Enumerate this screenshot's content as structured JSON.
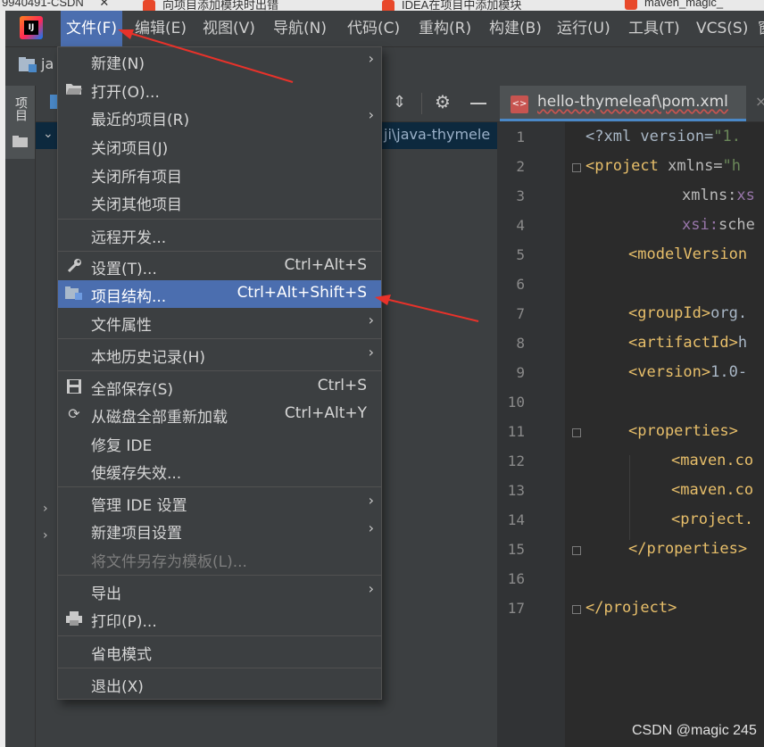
{
  "browser_tabs": [
    {
      "text": "9940491-CSDN"
    },
    {
      "text": "向项目添加模块时出错"
    },
    {
      "text": "IDEA在项目中添加模块"
    },
    {
      "text": "maven_magic_"
    }
  ],
  "menubar": {
    "items": [
      {
        "label": "文件(F)",
        "active": true
      },
      {
        "label": "编辑(E)"
      },
      {
        "label": "视图(V)"
      },
      {
        "label": "导航(N)"
      },
      {
        "label": "代码(C)"
      },
      {
        "label": "重构(R)"
      },
      {
        "label": "构建(B)"
      },
      {
        "label": "运行(U)"
      },
      {
        "label": "工具(T)"
      },
      {
        "label": "VCS(S)"
      },
      {
        "label": "窗"
      }
    ]
  },
  "navbar": {
    "project_label": "ja"
  },
  "tool_stripe": {
    "project_label": "项目"
  },
  "project_panel": {
    "path_fragment": "ji\\java-thymele"
  },
  "editor": {
    "tab_label": "hello-thymeleaf\\pom.xml",
    "tab_close": "×",
    "line_numbers": [
      "1",
      "2",
      "3",
      "4",
      "5",
      "6",
      "7",
      "8",
      "9",
      "10",
      "11",
      "12",
      "13",
      "14",
      "15",
      "16",
      "17"
    ]
  },
  "code": {
    "l1": {
      "a": "<?xml version=",
      "b": "\"1."
    },
    "l2": {
      "a": "<project ",
      "b": "xmlns=",
      "c": "\"h"
    },
    "l3": {
      "a": "xmlns:",
      "b": "xs"
    },
    "l4": {
      "a": "xsi:",
      "b": "sche"
    },
    "l5": {
      "a": "<modelVersion"
    },
    "l7": {
      "a": "<groupId>",
      "b": "org."
    },
    "l8": {
      "a": "<artifactId>",
      "b": "h"
    },
    "l9": {
      "a": "<version>",
      "b": "1.0-"
    },
    "l11": {
      "a": "<properties>"
    },
    "l12": {
      "a": "<maven.co"
    },
    "l13": {
      "a": "<maven.co"
    },
    "l14": {
      "a": "<project."
    },
    "l15": {
      "a": "</properties>"
    },
    "l17": {
      "a": "</project>"
    }
  },
  "file_menu": {
    "new": "新建(N)",
    "open": "打开(O)...",
    "recent": "最近的项目(R)",
    "close_project": "关闭项目(J)",
    "close_all": "关闭所有项目",
    "close_others": "关闭其他项目",
    "remote_dev": "远程开发...",
    "settings": "设置(T)...",
    "settings_shortcut": "Ctrl+Alt+S",
    "project_structure": "项目结构...",
    "project_structure_shortcut": "Ctrl+Alt+Shift+S",
    "file_properties": "文件属性",
    "local_history": "本地历史记录(H)",
    "save_all": "全部保存(S)",
    "save_all_shortcut": "Ctrl+S",
    "reload_all": "从磁盘全部重新加载",
    "reload_all_shortcut": "Ctrl+Alt+Y",
    "repair_ide": "修复 IDE",
    "invalidate_caches": "使缓存失效...",
    "manage_ide_settings": "管理 IDE 设置",
    "new_project_settings": "新建项目设置",
    "save_as_template": "将文件另存为模板(L)...",
    "export": "导出",
    "print": "打印(P)...",
    "power_save": "省电模式",
    "exit": "退出(X)"
  },
  "watermark": "CSDN @magic 245",
  "colors": {
    "menu_selection": "#4b6eaf",
    "annotation_arrow": "#e8322a",
    "xml_tag": "#e8bf6a",
    "xml_string": "#6a8759"
  }
}
